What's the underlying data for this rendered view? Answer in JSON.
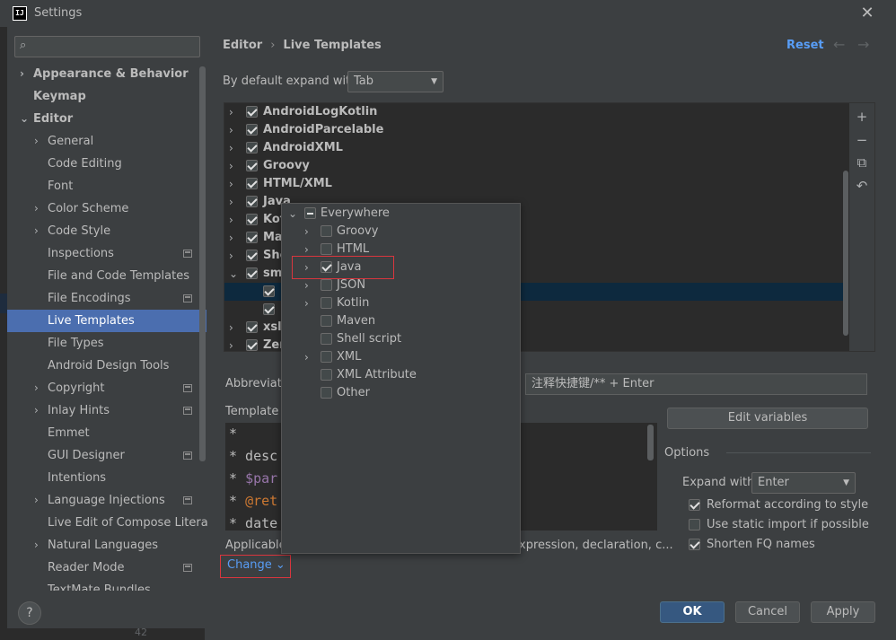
{
  "window": {
    "title": "Settings",
    "app_icon_text": "IJ",
    "close_glyph": "✕"
  },
  "search": {
    "placeholder": "",
    "icon": "search-icon"
  },
  "sidebar": {
    "items": [
      {
        "label": "Appearance & Behavior",
        "level": 0,
        "arrow": "›"
      },
      {
        "label": "Keymap",
        "level": 0,
        "arrow": ""
      },
      {
        "label": "Editor",
        "level": 0,
        "arrow": "⌄"
      },
      {
        "label": "General",
        "level": 1,
        "arrow": "›"
      },
      {
        "label": "Code Editing",
        "level": 1,
        "arrow": ""
      },
      {
        "label": "Font",
        "level": 1,
        "arrow": ""
      },
      {
        "label": "Color Scheme",
        "level": 1,
        "arrow": "›"
      },
      {
        "label": "Code Style",
        "level": 1,
        "arrow": "›"
      },
      {
        "label": "Inspections",
        "level": 1,
        "arrow": ""
      },
      {
        "label": "File and Code Templates",
        "level": 1,
        "arrow": ""
      },
      {
        "label": "File Encodings",
        "level": 1,
        "arrow": ""
      },
      {
        "label": "Live Templates",
        "level": 1,
        "arrow": ""
      },
      {
        "label": "File Types",
        "level": 1,
        "arrow": ""
      },
      {
        "label": "Android Design Tools",
        "level": 1,
        "arrow": ""
      },
      {
        "label": "Copyright",
        "level": 1,
        "arrow": "›"
      },
      {
        "label": "Inlay Hints",
        "level": 1,
        "arrow": "›"
      },
      {
        "label": "Emmet",
        "level": 1,
        "arrow": ""
      },
      {
        "label": "GUI Designer",
        "level": 1,
        "arrow": ""
      },
      {
        "label": "Intentions",
        "level": 1,
        "arrow": ""
      },
      {
        "label": "Language Injections",
        "level": 1,
        "arrow": "›"
      },
      {
        "label": "Live Edit of Compose Litera",
        "level": 1,
        "arrow": ""
      },
      {
        "label": "Natural Languages",
        "level": 1,
        "arrow": "›"
      },
      {
        "label": "Reader Mode",
        "level": 1,
        "arrow": ""
      },
      {
        "label": "TextMate Bundles",
        "level": 1,
        "arrow": ""
      }
    ]
  },
  "breadcrumb": {
    "parent": "Editor",
    "separator": "›",
    "current": "Live Templates"
  },
  "header": {
    "reset": "Reset",
    "back": "←",
    "forward": "→"
  },
  "expand_default": {
    "label": "By default expand with",
    "value": "Tab",
    "caret": "▼"
  },
  "template_groups": [
    {
      "label": "AndroidLogKotlin",
      "arrow": "›",
      "checked": true
    },
    {
      "label": "AndroidParcelable",
      "arrow": "›",
      "checked": true
    },
    {
      "label": "AndroidXML",
      "arrow": "›",
      "checked": true
    },
    {
      "label": "Groovy",
      "arrow": "›",
      "checked": true
    },
    {
      "label": "HTML/XML",
      "arrow": "›",
      "checked": true
    },
    {
      "label": "Java",
      "arrow": "›",
      "checked": true
    },
    {
      "label": "Kot",
      "arrow": "›",
      "checked": true
    },
    {
      "label": "Ma",
      "arrow": "›",
      "checked": true
    },
    {
      "label": "She",
      "arrow": "›",
      "checked": true
    },
    {
      "label": "smi",
      "arrow": "⌄",
      "checked": true
    },
    {
      "label": "",
      "arrow": "",
      "checked": true,
      "child": true,
      "selected": true
    },
    {
      "label": "",
      "arrow": "",
      "checked": true,
      "child": true
    },
    {
      "label": "xsl",
      "arrow": "›",
      "checked": true
    },
    {
      "label": "Zer",
      "arrow": "›",
      "checked": true
    }
  ],
  "tree_toolbar": {
    "add": "+",
    "remove": "−",
    "copy": "⧉",
    "restore": "↶"
  },
  "abbreviation": {
    "label": "Abbreviatio",
    "description_value": "注释快捷键/** + Enter"
  },
  "template_text": {
    "label": "Template t",
    "lines": [
      {
        "text": "*",
        "color": "#bbbbbb"
      },
      {
        "text": "* desc",
        "color": "#bbbbbb"
      },
      {
        "prefix": "* ",
        "text": "$par",
        "color": "#9876aa"
      },
      {
        "prefix": "* ",
        "text": "@ret",
        "color": "#cc7832"
      },
      {
        "text": "* date",
        "color": "#bbbbbb"
      }
    ]
  },
  "edit_variables": "Edit variables",
  "options": {
    "title": "Options",
    "expand_with_label": "Expand with",
    "expand_with_value": "Enter",
    "checks": [
      {
        "label": "Reformat according to style",
        "checked": true
      },
      {
        "label": "Use static import if possible",
        "checked": false
      },
      {
        "label": "Shorten FQ names",
        "checked": true
      }
    ]
  },
  "applicable": {
    "label": "Applicable",
    "contexts": "xpression, declaration, c..."
  },
  "change_link": "Change ⌄",
  "context_popup": {
    "rows": [
      {
        "label": "Everywhere",
        "arrow": "⌄",
        "state": "mixed",
        "level": 0
      },
      {
        "label": "Groovy",
        "arrow": "›",
        "state": "off",
        "level": 1
      },
      {
        "label": "HTML",
        "arrow": "›",
        "state": "off",
        "level": 1
      },
      {
        "label": "Java",
        "arrow": "›",
        "state": "on",
        "level": 1
      },
      {
        "label": "JSON",
        "arrow": "›",
        "state": "off",
        "level": 1
      },
      {
        "label": "Kotlin",
        "arrow": "›",
        "state": "off",
        "level": 1
      },
      {
        "label": "Maven",
        "arrow": "",
        "state": "off",
        "level": 1
      },
      {
        "label": "Shell script",
        "arrow": "",
        "state": "off",
        "level": 1
      },
      {
        "label": "XML",
        "arrow": "›",
        "state": "off",
        "level": 1
      },
      {
        "label": "XML Attribute",
        "arrow": "",
        "state": "off",
        "level": 1
      },
      {
        "label": "Other",
        "arrow": "",
        "state": "off",
        "level": 1
      }
    ]
  },
  "footer": {
    "help": "?",
    "ok": "OK",
    "cancel": "Cancel",
    "apply": "Apply"
  },
  "background_line_number": "42",
  "colors": {
    "accent": "#4b6eaf",
    "link": "#589df6",
    "highlight_box": "#d9363e",
    "selection_row": "#0d293e"
  }
}
